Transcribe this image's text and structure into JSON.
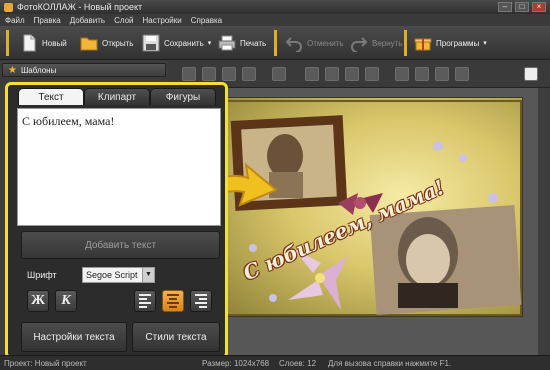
{
  "window": {
    "title": "ФотоКОЛЛАЖ - Новый проект"
  },
  "menu": [
    "Файл",
    "Правка",
    "Добавить",
    "Слой",
    "Настройки",
    "Справка"
  ],
  "toolbar": {
    "new_label": "Новый",
    "open_label": "Открыть",
    "save_label": "Сохранить",
    "print_label": "Печать",
    "undo_label": "Отменить",
    "redo_label": "Вернуть",
    "programs_label": "Программы"
  },
  "left_panel": {
    "section_label": "Шаблоны"
  },
  "text_panel": {
    "tabs": [
      "Текст",
      "Клипарт",
      "Фигуры"
    ],
    "active_tab": "Текст",
    "text_value": "С юбилеем, мама!",
    "add_text_label": "Добавить текст",
    "font_label": "Шрифт",
    "font_value": "Segoe Script",
    "bold_label": "Ж",
    "italic_label": "К",
    "text_settings_label": "Настройки текста",
    "text_styles_label": "Стили текста"
  },
  "collage": {
    "caption": "С юбилеем, мама!"
  },
  "status": {
    "project": "Проект: Новый проект",
    "size": "Размер: 1024x768",
    "layers": "Слоев: 12",
    "help": "Для вызова справки нажмите F1."
  },
  "colors": {
    "highlight_border": "#f2e035",
    "toolbar_separator": "#e0b020",
    "active_align": "#e99a32"
  }
}
